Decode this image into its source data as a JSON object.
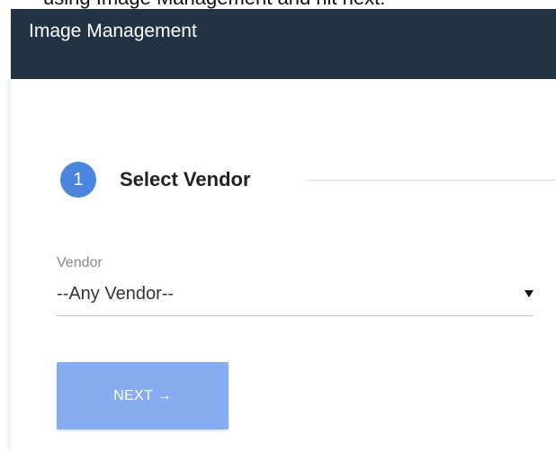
{
  "caption": {
    "text": "using Image Management and hit next."
  },
  "header": {
    "title": "Image Management"
  },
  "step": {
    "number": "1",
    "title": "Select Vendor"
  },
  "vendor_field": {
    "label": "Vendor",
    "value": "--Any Vendor--",
    "caret_icon": "triangle-down-icon"
  },
  "actions": {
    "next_label": "NEXT →"
  },
  "colors": {
    "header_bg": "#233346",
    "step_accent": "#4a86e0",
    "next_button_bg": "#86acf1"
  }
}
